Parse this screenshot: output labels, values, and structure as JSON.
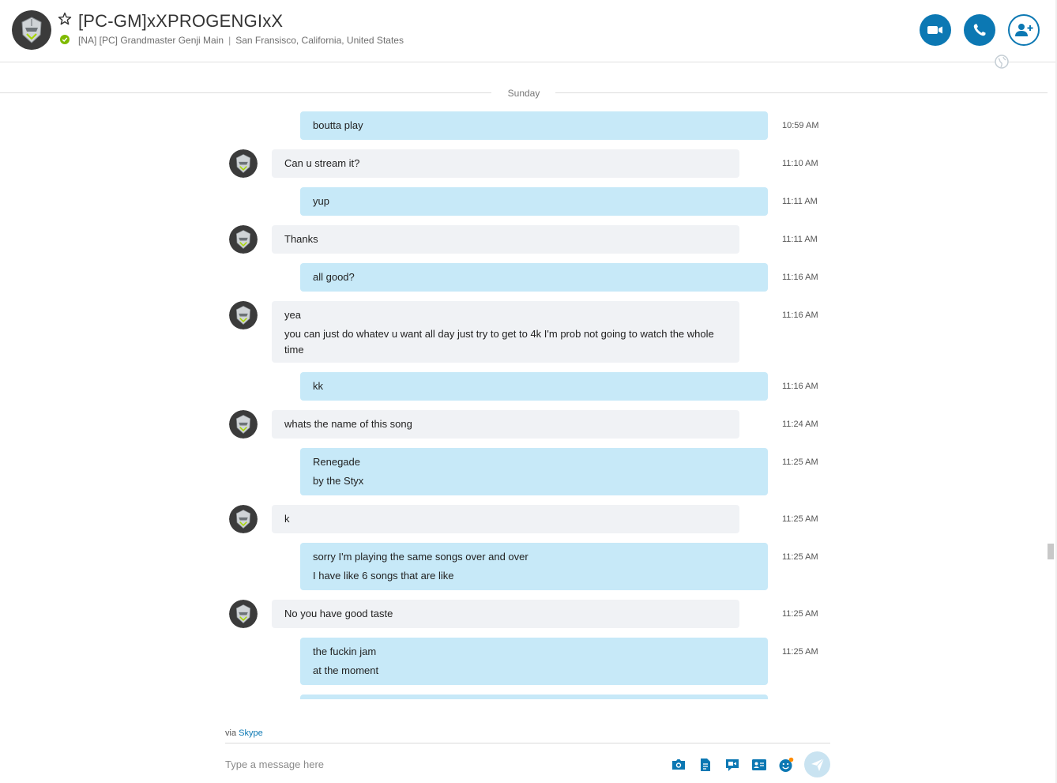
{
  "contact": {
    "name": "[PC-GM]xXPROGENGIxX",
    "mood": "[NA] [PC] Grandmaster Genji Main",
    "location": "San Fransisco, California, United States",
    "status_color": "#7fba00"
  },
  "header_actions": {
    "video_call": "video-call-icon",
    "audio_call": "phone-icon",
    "add_people": "add-person-icon"
  },
  "conversation": {
    "date_label": "Sunday",
    "messages": [
      {
        "from": "me",
        "lines": [
          "boutta play"
        ],
        "time": "10:59 AM"
      },
      {
        "from": "them",
        "lines": [
          "Can u stream it?"
        ],
        "time": "11:10 AM"
      },
      {
        "from": "me",
        "lines": [
          "yup"
        ],
        "time": "11:11 AM"
      },
      {
        "from": "them",
        "lines": [
          "Thanks"
        ],
        "time": "11:11 AM"
      },
      {
        "from": "me",
        "lines": [
          "all good?"
        ],
        "time": "11:16 AM"
      },
      {
        "from": "them",
        "lines": [
          "yea",
          "you can just do whatev u want all day just try to get to 4k I'm prob not going to watch the whole time"
        ],
        "time": "11:16 AM"
      },
      {
        "from": "me",
        "lines": [
          "kk"
        ],
        "time": "11:16 AM"
      },
      {
        "from": "them",
        "lines": [
          "whats the name of this song"
        ],
        "time": "11:24 AM"
      },
      {
        "from": "me",
        "lines": [
          "Renegade",
          "by the Styx"
        ],
        "time": "11:25 AM"
      },
      {
        "from": "them",
        "lines": [
          "k"
        ],
        "time": "11:25 AM"
      },
      {
        "from": "me",
        "lines": [
          "sorry I'm playing the same songs over and over",
          "I have like 6 songs that are like"
        ],
        "time": "11:25 AM"
      },
      {
        "from": "them",
        "lines": [
          "No you have good taste"
        ],
        "time": "11:25 AM"
      },
      {
        "from": "me",
        "lines": [
          "the fuckin jam",
          "at the moment"
        ],
        "time": "11:25 AM"
      }
    ]
  },
  "footer": {
    "via_prefix": "via",
    "via_link": "Skype",
    "input_placeholder": "Type a message here",
    "icons": [
      "send-media-icon",
      "send-file-icon",
      "video-message-icon",
      "send-contact-icon",
      "emoticon-icon",
      "send-icon"
    ]
  },
  "colors": {
    "accent": "#0c78b3",
    "my_bubble": "#c7e9f8",
    "their_bubble": "#f0f2f5"
  }
}
